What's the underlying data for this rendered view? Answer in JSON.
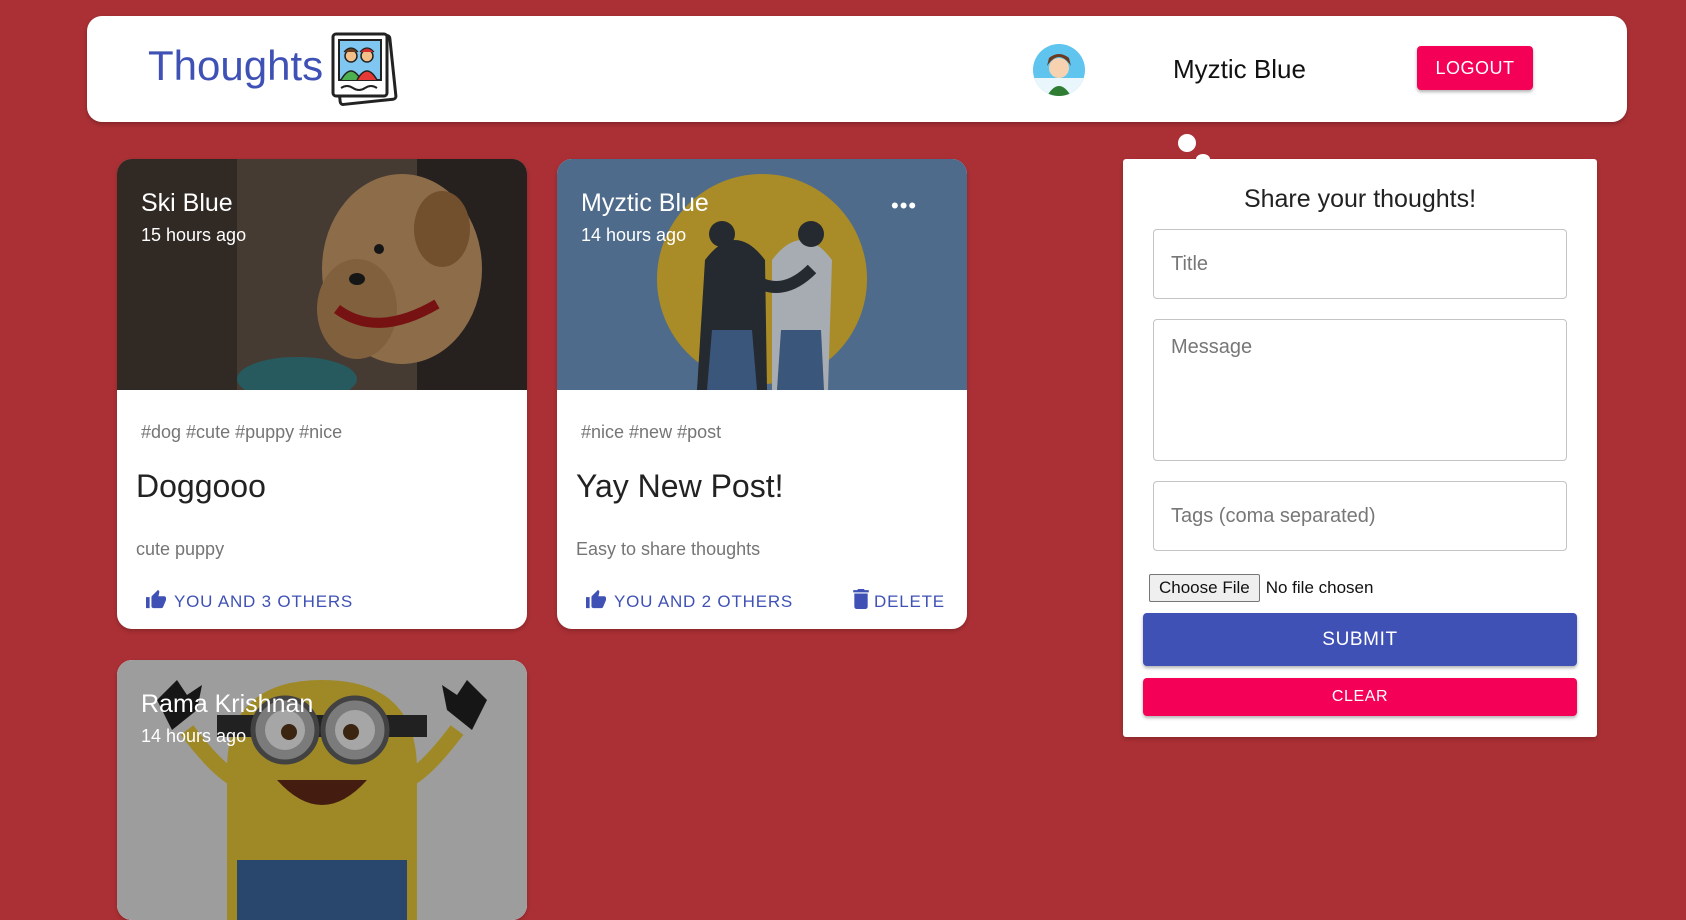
{
  "header": {
    "app_title": "Thoughts",
    "user_name": "Myztic Blue",
    "logout_label": "LOGOUT"
  },
  "posts": [
    {
      "author": "Ski Blue",
      "time": "15 hours ago",
      "tags": "#dog #cute #puppy #nice",
      "title": "Doggooo",
      "message": "cute puppy",
      "likes_label": "YOU AND 3 OTHERS",
      "image": "puppy-photo"
    },
    {
      "author": "Myztic Blue",
      "time": "14 hours ago",
      "tags": "#nice #new #post",
      "title": "Yay New Post!",
      "message": "Easy to share thoughts",
      "likes_label": "YOU AND 2 OTHERS",
      "delete_label": "DELETE",
      "more_label": "•••",
      "image": "friends-illustration"
    },
    {
      "author": "Rama Krishnan",
      "time": "14 hours ago",
      "image": "minion-photo"
    }
  ],
  "form": {
    "heading": "Share your thoughts!",
    "title_placeholder": "Title",
    "message_placeholder": "Message",
    "tags_placeholder": "Tags (coma separated)",
    "file_button_label": "Choose File",
    "file_status": "No file chosen",
    "submit_label": "SUBMIT",
    "clear_label": "CLEAR"
  },
  "colors": {
    "background": "#ab3035",
    "primary": "#3f51b5",
    "secondary": "#f50057"
  },
  "icons": [
    "thumb-up-icon",
    "trash-icon",
    "more-horizontal-icon",
    "photo-logo-icon"
  ]
}
